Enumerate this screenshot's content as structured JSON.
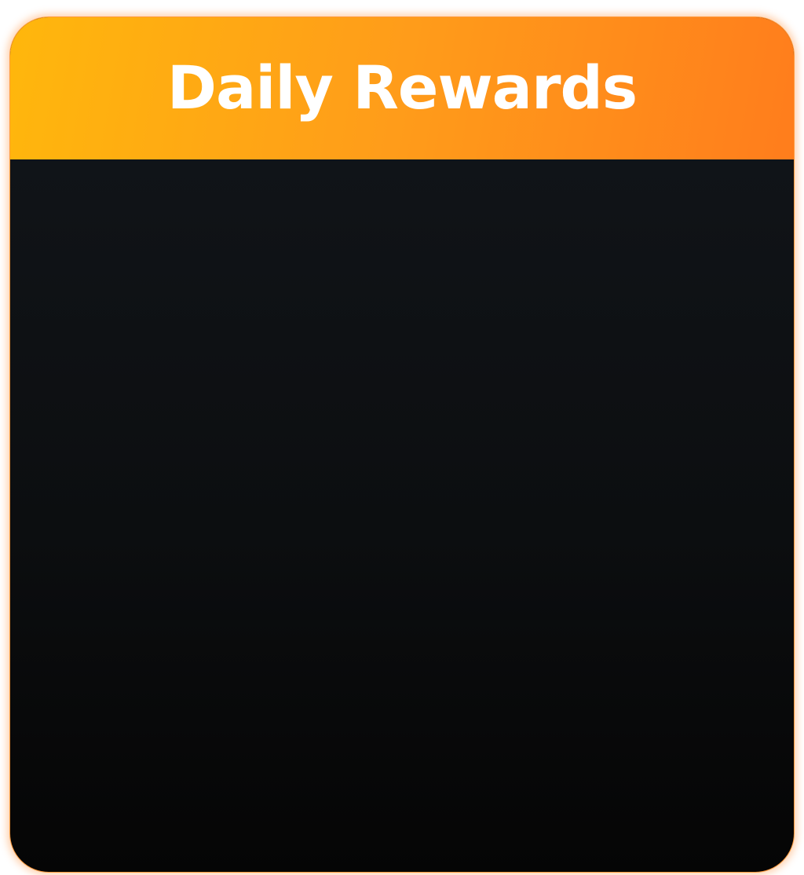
{
  "dialog": {
    "title": "Daily Rewards"
  },
  "colors": {
    "header_gradient_start": "#ffb70c",
    "header_gradient_end": "#ff7d1c",
    "body_background_top": "#12161b",
    "body_background_bottom": "#050505",
    "border_glow": "#ff9a3c",
    "title_text": "#ffffff"
  }
}
